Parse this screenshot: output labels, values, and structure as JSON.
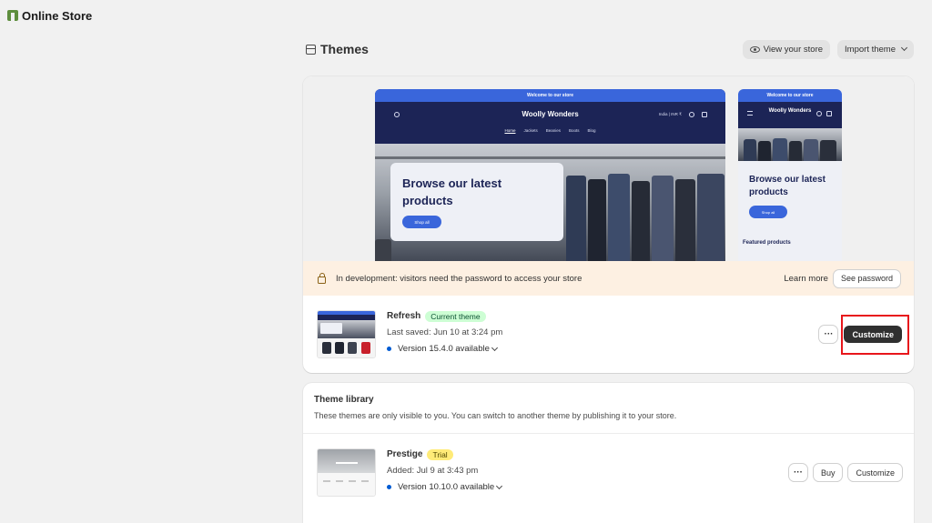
{
  "topbar": {
    "app_title": "Online Store"
  },
  "header": {
    "title": "Themes",
    "view_store_label": "View your store",
    "import_theme_label": "Import theme"
  },
  "preview": {
    "desktop": {
      "announcement": "Welcome to our store",
      "brand": "Woolly Wonders",
      "locale": "India | INR ₹",
      "nav": [
        "Home",
        "Jackets",
        "Beanies",
        "Boots",
        "Blog"
      ],
      "hero_title": "Browse our latest products",
      "hero_button": "Shop all"
    },
    "mobile": {
      "announcement": "Welcome to our store",
      "brand": "Woolly Wonders",
      "hero_title": "Browse our latest products",
      "hero_button": "Shop all",
      "featured": "Featured products"
    }
  },
  "banner": {
    "message": "In development: visitors need the password to access your store",
    "learn_more": "Learn more",
    "see_password": "See password"
  },
  "current_theme": {
    "name": "Refresh",
    "badge": "Current theme",
    "last_saved": "Last saved: Jun 10 at 3:24 pm",
    "version": "Version 15.4.0 available",
    "more_label": "···",
    "customize_label": "Customize"
  },
  "library": {
    "title": "Theme library",
    "description": "These themes are only visible to you. You can switch to another theme by publishing it to your store.",
    "themes": [
      {
        "name": "Prestige",
        "badge": "Trial",
        "added": "Added: Jul 9 at 3:43 pm",
        "version": "Version 10.10.0 available",
        "more_label": "···",
        "buy_label": "Buy",
        "customize_label": "Customize"
      }
    ]
  },
  "colors": {
    "accent_blue": "#3a66db",
    "store_navy": "#1c2456",
    "highlight_red": "#e8161b",
    "banner_bg": "#fdf0e2"
  }
}
